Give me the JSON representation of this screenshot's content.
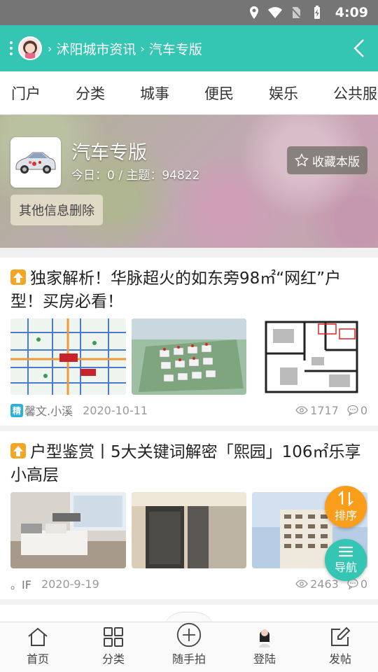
{
  "status_bar": {
    "time": "4:09"
  },
  "header": {
    "crumbs": [
      "沭阳城市资讯",
      "汽车专版"
    ]
  },
  "tabs": [
    "门户",
    "分类",
    "城事",
    "便民",
    "娱乐",
    "公共服"
  ],
  "forum": {
    "title": "汽车专版",
    "stats": "今日：0 / 主题：94822",
    "fav_label": "收藏本版",
    "other_info": "其他信息删除"
  },
  "posts": [
    {
      "title": "独家解析！华脉超火的如东旁98㎡“网红”户型！买房必看！",
      "badge": "精",
      "author": "馨文.小溪",
      "date": "2020-10-11",
      "views": "1717",
      "comments": "0"
    },
    {
      "title": "户型鉴赏丨5大关键词解密「熙园」106㎡乐享小高层",
      "author": "。IF",
      "date": "2020-9-19",
      "views": "2463",
      "comments": "0"
    }
  ],
  "fabs": {
    "sort": "排序",
    "nav": "导航"
  },
  "bottom_nav": [
    "首页",
    "分类",
    "随手拍",
    "登陆",
    "发帖"
  ],
  "colors": {
    "brand": "#35c6b3",
    "accent": "#fa9d1b"
  }
}
